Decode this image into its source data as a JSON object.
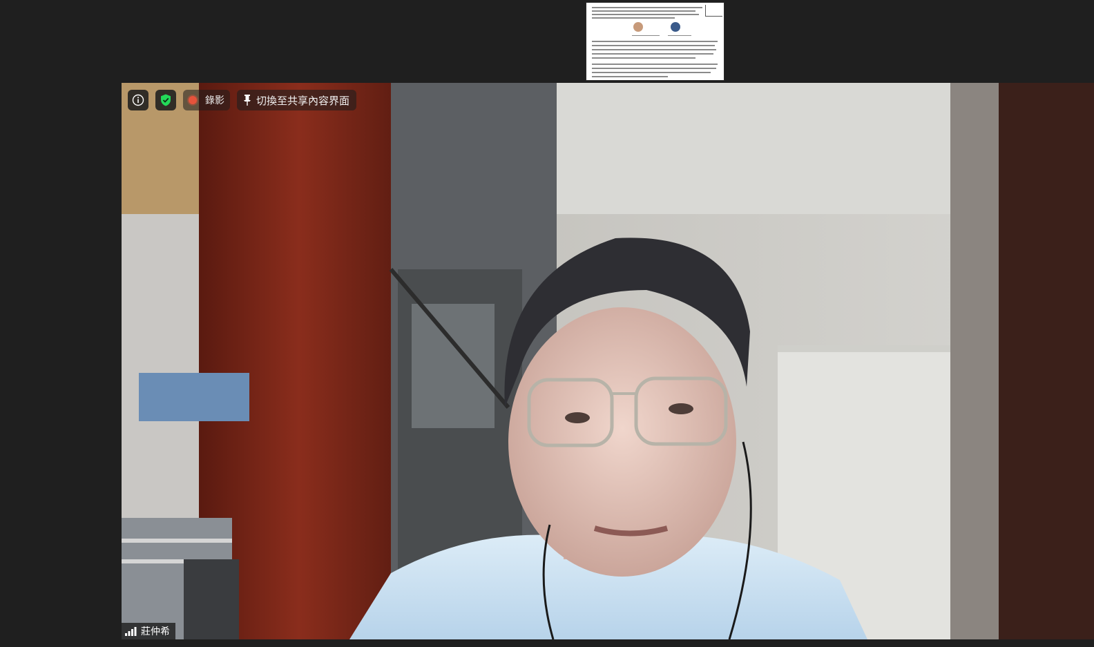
{
  "window": {
    "background": "#1f1f1f"
  },
  "shared_screen_thumbnail": {
    "icon": "shared-document-thumbnail"
  },
  "toolbar": {
    "info_icon": "info-icon",
    "security_icon": "shield-check-icon",
    "recording_label": "錄影",
    "switch_label": "切換至共享內容界面",
    "switch_icon": "pin-icon"
  },
  "participant": {
    "name": "莊仲希",
    "signal_icon": "signal-bars-icon"
  },
  "colors": {
    "recording": "#e5533b",
    "security": "#23d959"
  }
}
